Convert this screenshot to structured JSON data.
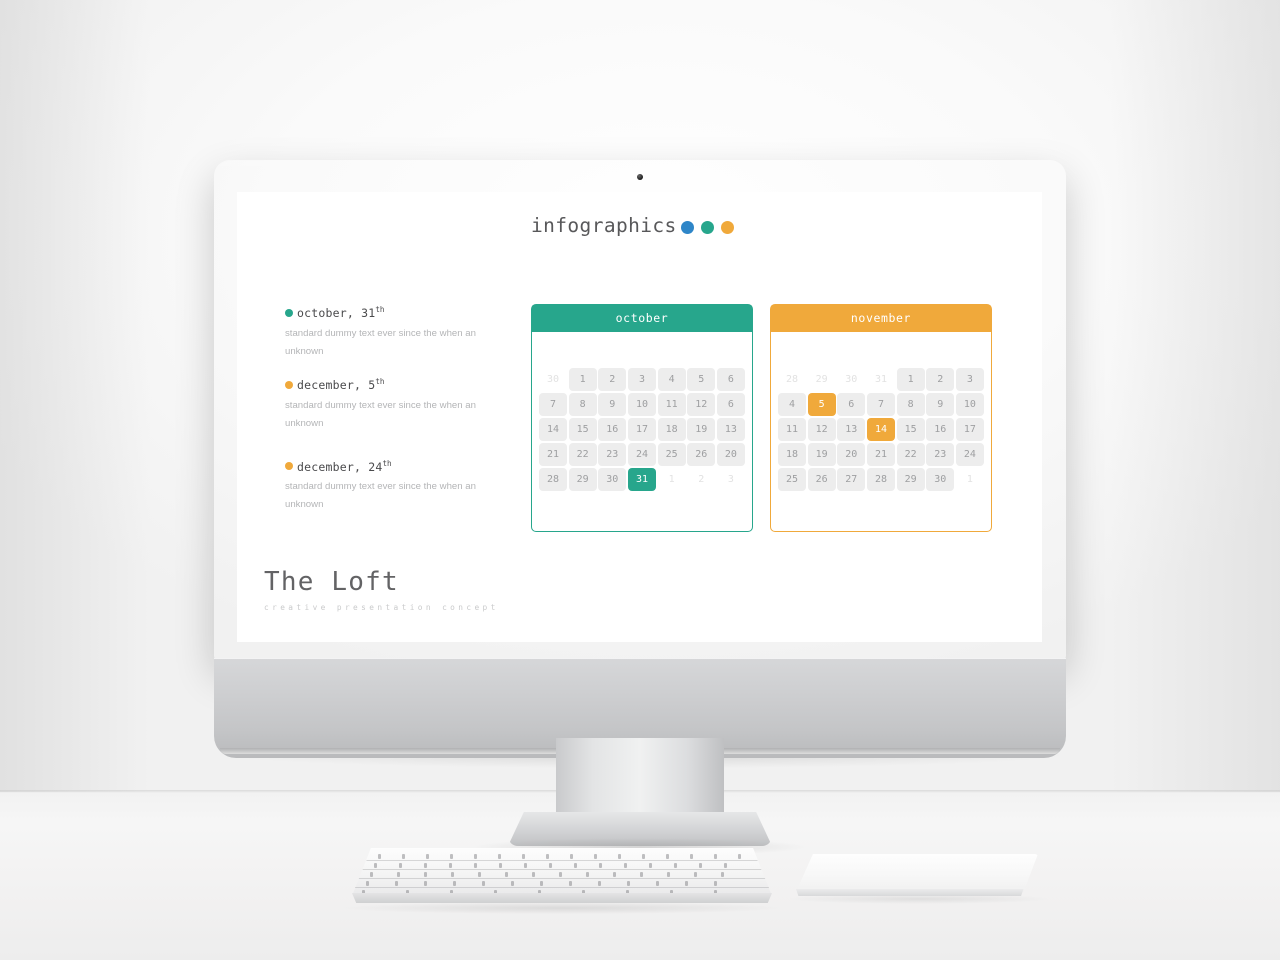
{
  "slide": {
    "title_text": "infographics",
    "title_dots": [
      {
        "name": "dot-blue",
        "color": "#2e86c8"
      },
      {
        "name": "dot-teal",
        "color": "#27a68c"
      },
      {
        "name": "dot-orange",
        "color": "#f0a93b"
      }
    ],
    "legend": [
      {
        "bullet_color": "#27a68c",
        "heading": "october, 31",
        "suffix": "th",
        "body": "standard dummy text ever since the when an unknown"
      },
      {
        "bullet_color": "#f0a93b",
        "heading": "december, 5",
        "suffix": "th",
        "body": "standard dummy text ever since the when an unknown"
      },
      {
        "bullet_color": "#f0a93b",
        "heading": "december, 24",
        "suffix": "th",
        "body": "standard dummy text ever since the when an unknown"
      }
    ],
    "calendars": [
      {
        "name": "october",
        "title": "october",
        "accent": "#27a68c",
        "weeks": [
          [
            {
              "d": "30",
              "s": "muted"
            },
            {
              "d": "1",
              "s": "filled"
            },
            {
              "d": "2",
              "s": "filled"
            },
            {
              "d": "3",
              "s": "filled"
            },
            {
              "d": "4",
              "s": "filled"
            },
            {
              "d": "5",
              "s": "filled"
            },
            {
              "d": "6",
              "s": "filled"
            }
          ],
          [
            {
              "d": "7",
              "s": "filled"
            },
            {
              "d": "8",
              "s": "filled"
            },
            {
              "d": "9",
              "s": "filled"
            },
            {
              "d": "10",
              "s": "filled"
            },
            {
              "d": "11",
              "s": "filled"
            },
            {
              "d": "12",
              "s": "filled"
            },
            {
              "d": "6",
              "s": "filled"
            }
          ],
          [
            {
              "d": "14",
              "s": "filled"
            },
            {
              "d": "15",
              "s": "filled"
            },
            {
              "d": "16",
              "s": "filled"
            },
            {
              "d": "17",
              "s": "filled"
            },
            {
              "d": "18",
              "s": "filled"
            },
            {
              "d": "19",
              "s": "filled"
            },
            {
              "d": "13",
              "s": "filled"
            }
          ],
          [
            {
              "d": "21",
              "s": "filled"
            },
            {
              "d": "22",
              "s": "filled"
            },
            {
              "d": "23",
              "s": "filled"
            },
            {
              "d": "24",
              "s": "filled"
            },
            {
              "d": "25",
              "s": "filled"
            },
            {
              "d": "26",
              "s": "filled"
            },
            {
              "d": "20",
              "s": "filled"
            }
          ],
          [
            {
              "d": "28",
              "s": "filled"
            },
            {
              "d": "29",
              "s": "filled"
            },
            {
              "d": "30",
              "s": "filled"
            },
            {
              "d": "31",
              "s": "hl-teal"
            },
            {
              "d": "1",
              "s": "muted"
            },
            {
              "d": "2",
              "s": "muted"
            },
            {
              "d": "3",
              "s": "muted"
            }
          ]
        ]
      },
      {
        "name": "november",
        "title": "november",
        "accent": "#f0a93b",
        "weeks": [
          [
            {
              "d": "28",
              "s": "muted"
            },
            {
              "d": "29",
              "s": "muted"
            },
            {
              "d": "30",
              "s": "muted"
            },
            {
              "d": "31",
              "s": "muted"
            },
            {
              "d": "1",
              "s": "filled"
            },
            {
              "d": "2",
              "s": "filled"
            },
            {
              "d": "3",
              "s": "filled"
            }
          ],
          [
            {
              "d": "4",
              "s": "filled"
            },
            {
              "d": "5",
              "s": "hl-orange"
            },
            {
              "d": "6",
              "s": "filled"
            },
            {
              "d": "7",
              "s": "filled"
            },
            {
              "d": "8",
              "s": "filled"
            },
            {
              "d": "9",
              "s": "filled"
            },
            {
              "d": "10",
              "s": "filled"
            }
          ],
          [
            {
              "d": "11",
              "s": "filled"
            },
            {
              "d": "12",
              "s": "filled"
            },
            {
              "d": "13",
              "s": "filled"
            },
            {
              "d": "14",
              "s": "hl-orange"
            },
            {
              "d": "15",
              "s": "filled"
            },
            {
              "d": "16",
              "s": "filled"
            },
            {
              "d": "17",
              "s": "filled"
            }
          ],
          [
            {
              "d": "18",
              "s": "filled"
            },
            {
              "d": "19",
              "s": "filled"
            },
            {
              "d": "20",
              "s": "filled"
            },
            {
              "d": "21",
              "s": "filled"
            },
            {
              "d": "22",
              "s": "filled"
            },
            {
              "d": "23",
              "s": "filled"
            },
            {
              "d": "24",
              "s": "filled"
            }
          ],
          [
            {
              "d": "25",
              "s": "filled"
            },
            {
              "d": "26",
              "s": "filled"
            },
            {
              "d": "27",
              "s": "filled"
            },
            {
              "d": "28",
              "s": "filled"
            },
            {
              "d": "29",
              "s": "filled"
            },
            {
              "d": "30",
              "s": "filled"
            },
            {
              "d": "1",
              "s": "muted"
            }
          ]
        ]
      }
    ],
    "brand": {
      "title": "The Loft",
      "subtitle": "creative presentation concept"
    }
  }
}
